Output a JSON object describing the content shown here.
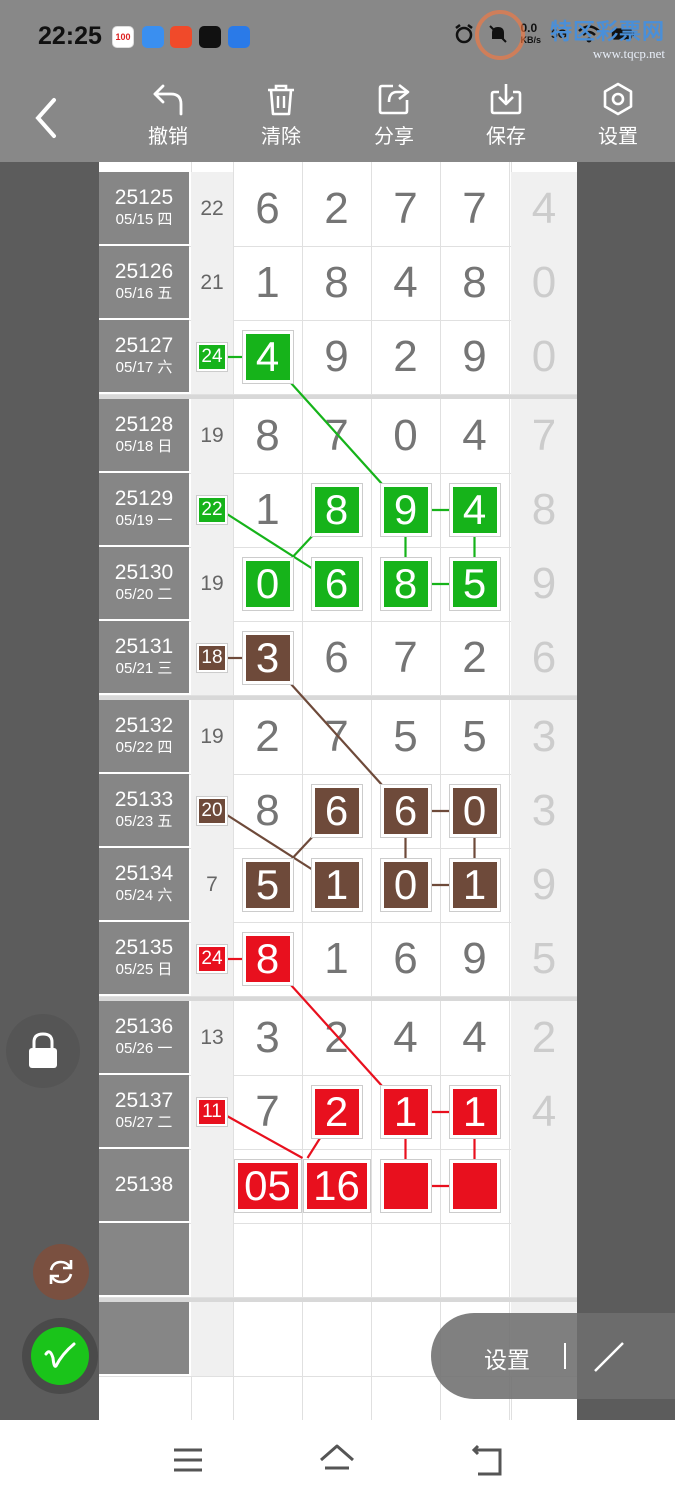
{
  "status_bar": {
    "time": "22:25",
    "net_speed_value": "0.0",
    "net_speed_unit": "KB/s",
    "signal": "5G",
    "app_icons": [
      "100-app-icon",
      "cloud-app-icon",
      "red-app-icon",
      "capcut-icon",
      "blue-app-icon"
    ]
  },
  "watermark": {
    "title": "特区彩票网",
    "url": "www.tqcp.net"
  },
  "toolbar": {
    "undo_label": "撤销",
    "clear_label": "清除",
    "share_label": "分享",
    "save_label": "保存",
    "settings_label": "设置"
  },
  "rows": [
    {
      "issue": "25125",
      "date": "05/15 四",
      "sum": "22",
      "digits": [
        "6",
        "2",
        "7",
        "7"
      ],
      "extra": "4"
    },
    {
      "issue": "25126",
      "date": "05/16 五",
      "sum": "21",
      "digits": [
        "1",
        "8",
        "4",
        "8"
      ],
      "extra": "0"
    },
    {
      "issue": "25127",
      "date": "05/17 六",
      "sum": "24",
      "digits": [
        "4",
        "9",
        "2",
        "9"
      ],
      "extra": "0"
    },
    {
      "issue": "25128",
      "date": "05/18 日",
      "sum": "19",
      "digits": [
        "8",
        "7",
        "0",
        "4"
      ],
      "extra": "7"
    },
    {
      "issue": "25129",
      "date": "05/19 一",
      "sum": "22",
      "digits": [
        "1",
        "8",
        "9",
        "4"
      ],
      "extra": "8"
    },
    {
      "issue": "25130",
      "date": "05/20 二",
      "sum": "19",
      "digits": [
        "0",
        "6",
        "8",
        "5"
      ],
      "extra": "9"
    },
    {
      "issue": "25131",
      "date": "05/21 三",
      "sum": "18",
      "digits": [
        "3",
        "6",
        "7",
        "2"
      ],
      "extra": "6"
    },
    {
      "issue": "25132",
      "date": "05/22 四",
      "sum": "19",
      "digits": [
        "2",
        "7",
        "5",
        "5"
      ],
      "extra": "3"
    },
    {
      "issue": "25133",
      "date": "05/23 五",
      "sum": "20",
      "digits": [
        "8",
        "6",
        "6",
        "0"
      ],
      "extra": "3"
    },
    {
      "issue": "25134",
      "date": "05/24 六",
      "sum": "7",
      "digits": [
        "5",
        "1",
        "0",
        "1"
      ],
      "extra": "9"
    },
    {
      "issue": "25135",
      "date": "05/25 日",
      "sum": "24",
      "digits": [
        "8",
        "1",
        "6",
        "9"
      ],
      "extra": "5"
    },
    {
      "issue": "25136",
      "date": "05/26 一",
      "sum": "13",
      "digits": [
        "3",
        "2",
        "4",
        "4"
      ],
      "extra": "2"
    },
    {
      "issue": "25137",
      "date": "05/27 二",
      "sum": "11",
      "digits": [
        "7",
        "2",
        "1",
        "1"
      ],
      "extra": "4"
    },
    {
      "issue": "25138",
      "date": "",
      "sum": "",
      "digits": [
        "05",
        "16",
        "",
        ""
      ],
      "extra": ""
    }
  ],
  "highlights": {
    "green_color": "#16b31a",
    "brown_color": "#6e4a3a",
    "red_color": "#e8101e"
  },
  "float_pill": {
    "settings_label": "设置"
  },
  "icons": [
    "back-icon",
    "undo-icon",
    "trash-icon",
    "share-icon",
    "download-icon",
    "settings-icon",
    "lock-icon",
    "refresh-icon",
    "pen-icon",
    "slash-icon",
    "menu-icon",
    "home-icon",
    "back-nav-icon"
  ]
}
